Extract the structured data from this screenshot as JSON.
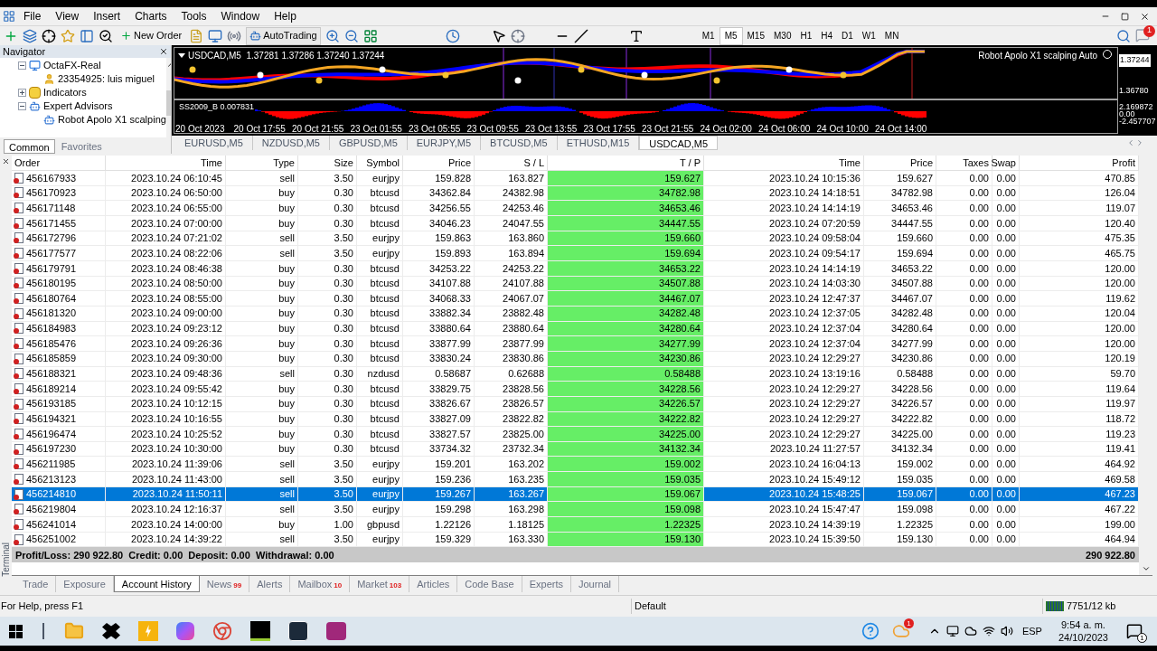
{
  "menu": [
    "File",
    "View",
    "Insert",
    "Charts",
    "Tools",
    "Window",
    "Help"
  ],
  "toolbar": {
    "new_order": "New Order",
    "autotrading": "AutoTrading",
    "timeframes": [
      {
        "label": "M1",
        "selected": false
      },
      {
        "label": "M5",
        "selected": true
      },
      {
        "label": "M15",
        "selected": false
      },
      {
        "label": "M30",
        "selected": false
      },
      {
        "label": "H1",
        "selected": false
      },
      {
        "label": "H4",
        "selected": false
      },
      {
        "label": "D1",
        "selected": false
      },
      {
        "label": "W1",
        "selected": false
      },
      {
        "label": "MN",
        "selected": false
      }
    ],
    "notifications": "1"
  },
  "navigator": {
    "title": "Navigator",
    "tree": [
      {
        "label": "OctaFX-Real",
        "kind": "server",
        "expanded": true,
        "children": [
          {
            "label": "23354925: luis miguel",
            "kind": "account"
          }
        ]
      },
      {
        "label": "Indicators",
        "kind": "indicators",
        "expanded": false
      },
      {
        "label": "Expert Advisors",
        "kind": "experts",
        "expanded": true,
        "children": [
          {
            "label": "Robot Apolo X1 scalping",
            "kind": "expert"
          }
        ]
      }
    ],
    "tabs": [
      {
        "label": "Common",
        "selected": true
      },
      {
        "label": "Favorites",
        "selected": false
      }
    ]
  },
  "chart": {
    "legend": "USDCAD,M5  1.37281 1.37286 1.37240 1.37244",
    "expert": "Robot Apolo X1 scalping Auto",
    "price_current": "1.37244",
    "price_label": "1.36780",
    "indicator_legend": "SS2009_B 0.007831",
    "indicator_scale": [
      "2.169872",
      "0.00",
      "-2.457707"
    ],
    "time_labels": [
      "20 Oct 2023",
      "20 Oct 17:55",
      "20 Oct 21:55",
      "23 Oct 01:55",
      "23 Oct 05:55",
      "23 Oct 09:55",
      "23 Oct 13:55",
      "23 Oct 17:55",
      "23 Oct 21:55",
      "24 Oct 02:00",
      "24 Oct 06:00",
      "24 Oct 10:00",
      "24 Oct 14:00"
    ]
  },
  "chart_tabs": [
    {
      "label": "EURUSD,M5",
      "selected": false
    },
    {
      "label": "NZDUSD,M5",
      "selected": false
    },
    {
      "label": "GBPUSD,M5",
      "selected": false
    },
    {
      "label": "EURJPY,M5",
      "selected": false
    },
    {
      "label": "BTCUSD,M5",
      "selected": false
    },
    {
      "label": "ETHUSD,M15",
      "selected": false
    },
    {
      "label": "USDCAD,M5",
      "selected": true
    }
  ],
  "table": {
    "columns": [
      "Order",
      "Time",
      "Type",
      "Size",
      "Symbol",
      "Price",
      "S / L",
      "T / P",
      "Time",
      "Price",
      "Taxes",
      "Swap",
      "Profit"
    ],
    "rows": [
      {
        "selected": false,
        "tp_hit": true,
        "cells": [
          "456167933",
          "2023.10.24 06:10:45",
          "sell",
          "3.50",
          "eurjpy",
          "159.828",
          "163.827",
          "159.627",
          "2023.10.24 10:15:36",
          "159.627",
          "0.00",
          "0.00",
          "470.85"
        ]
      },
      {
        "selected": false,
        "tp_hit": true,
        "cells": [
          "456170923",
          "2023.10.24 06:50:00",
          "buy",
          "0.30",
          "btcusd",
          "34362.84",
          "24382.98",
          "34782.98",
          "2023.10.24 14:18:51",
          "34782.98",
          "0.00",
          "0.00",
          "126.04"
        ]
      },
      {
        "selected": false,
        "tp_hit": true,
        "cells": [
          "456171148",
          "2023.10.24 06:55:00",
          "buy",
          "0.30",
          "btcusd",
          "34256.55",
          "24253.46",
          "34653.46",
          "2023.10.24 14:14:19",
          "34653.46",
          "0.00",
          "0.00",
          "119.07"
        ]
      },
      {
        "selected": false,
        "tp_hit": true,
        "cells": [
          "456171455",
          "2023.10.24 07:00:00",
          "buy",
          "0.30",
          "btcusd",
          "34046.23",
          "24047.55",
          "34447.55",
          "2023.10.24 07:20:59",
          "34447.55",
          "0.00",
          "0.00",
          "120.40"
        ]
      },
      {
        "selected": false,
        "tp_hit": true,
        "cells": [
          "456172796",
          "2023.10.24 07:21:02",
          "sell",
          "3.50",
          "eurjpy",
          "159.863",
          "163.860",
          "159.660",
          "2023.10.24 09:58:04",
          "159.660",
          "0.00",
          "0.00",
          "475.35"
        ]
      },
      {
        "selected": false,
        "tp_hit": true,
        "cells": [
          "456177577",
          "2023.10.24 08:22:06",
          "sell",
          "3.50",
          "eurjpy",
          "159.893",
          "163.894",
          "159.694",
          "2023.10.24 09:54:17",
          "159.694",
          "0.00",
          "0.00",
          "465.75"
        ]
      },
      {
        "selected": false,
        "tp_hit": true,
        "cells": [
          "456179791",
          "2023.10.24 08:46:38",
          "buy",
          "0.30",
          "btcusd",
          "34253.22",
          "24253.22",
          "34653.22",
          "2023.10.24 14:14:19",
          "34653.22",
          "0.00",
          "0.00",
          "120.00"
        ]
      },
      {
        "selected": false,
        "tp_hit": true,
        "cells": [
          "456180195",
          "2023.10.24 08:50:00",
          "buy",
          "0.30",
          "btcusd",
          "34107.88",
          "24107.88",
          "34507.88",
          "2023.10.24 14:03:30",
          "34507.88",
          "0.00",
          "0.00",
          "120.00"
        ]
      },
      {
        "selected": false,
        "tp_hit": true,
        "cells": [
          "456180764",
          "2023.10.24 08:55:00",
          "buy",
          "0.30",
          "btcusd",
          "34068.33",
          "24067.07",
          "34467.07",
          "2023.10.24 12:47:37",
          "34467.07",
          "0.00",
          "0.00",
          "119.62"
        ]
      },
      {
        "selected": false,
        "tp_hit": true,
        "cells": [
          "456181320",
          "2023.10.24 09:00:00",
          "buy",
          "0.30",
          "btcusd",
          "33882.34",
          "23882.48",
          "34282.48",
          "2023.10.24 12:37:05",
          "34282.48",
          "0.00",
          "0.00",
          "120.04"
        ]
      },
      {
        "selected": false,
        "tp_hit": true,
        "cells": [
          "456184983",
          "2023.10.24 09:23:12",
          "buy",
          "0.30",
          "btcusd",
          "33880.64",
          "23880.64",
          "34280.64",
          "2023.10.24 12:37:04",
          "34280.64",
          "0.00",
          "0.00",
          "120.00"
        ]
      },
      {
        "selected": false,
        "tp_hit": true,
        "cells": [
          "456185476",
          "2023.10.24 09:26:36",
          "buy",
          "0.30",
          "btcusd",
          "33877.99",
          "23877.99",
          "34277.99",
          "2023.10.24 12:37:04",
          "34277.99",
          "0.00",
          "0.00",
          "120.00"
        ]
      },
      {
        "selected": false,
        "tp_hit": true,
        "cells": [
          "456185859",
          "2023.10.24 09:30:00",
          "buy",
          "0.30",
          "btcusd",
          "33830.24",
          "23830.86",
          "34230.86",
          "2023.10.24 12:29:27",
          "34230.86",
          "0.00",
          "0.00",
          "120.19"
        ]
      },
      {
        "selected": false,
        "tp_hit": true,
        "cells": [
          "456188321",
          "2023.10.24 09:48:36",
          "sell",
          "0.30",
          "nzdusd",
          "0.58687",
          "0.62688",
          "0.58488",
          "2023.10.24 13:19:16",
          "0.58488",
          "0.00",
          "0.00",
          "59.70"
        ]
      },
      {
        "selected": false,
        "tp_hit": true,
        "cells": [
          "456189214",
          "2023.10.24 09:55:42",
          "buy",
          "0.30",
          "btcusd",
          "33829.75",
          "23828.56",
          "34228.56",
          "2023.10.24 12:29:27",
          "34228.56",
          "0.00",
          "0.00",
          "119.64"
        ]
      },
      {
        "selected": false,
        "tp_hit": true,
        "cells": [
          "456193185",
          "2023.10.24 10:12:15",
          "buy",
          "0.30",
          "btcusd",
          "33826.67",
          "23826.57",
          "34226.57",
          "2023.10.24 12:29:27",
          "34226.57",
          "0.00",
          "0.00",
          "119.97"
        ]
      },
      {
        "selected": false,
        "tp_hit": true,
        "cells": [
          "456194321",
          "2023.10.24 10:16:55",
          "buy",
          "0.30",
          "btcusd",
          "33827.09",
          "23822.82",
          "34222.82",
          "2023.10.24 12:29:27",
          "34222.82",
          "0.00",
          "0.00",
          "118.72"
        ]
      },
      {
        "selected": false,
        "tp_hit": true,
        "cells": [
          "456196474",
          "2023.10.24 10:25:52",
          "buy",
          "0.30",
          "btcusd",
          "33827.57",
          "23825.00",
          "34225.00",
          "2023.10.24 12:29:27",
          "34225.00",
          "0.00",
          "0.00",
          "119.23"
        ]
      },
      {
        "selected": false,
        "tp_hit": true,
        "cells": [
          "456197230",
          "2023.10.24 10:30:00",
          "buy",
          "0.30",
          "btcusd",
          "33734.32",
          "23732.34",
          "34132.34",
          "2023.10.24 11:27:57",
          "34132.34",
          "0.00",
          "0.00",
          "119.41"
        ]
      },
      {
        "selected": false,
        "tp_hit": true,
        "cells": [
          "456211985",
          "2023.10.24 11:39:06",
          "sell",
          "3.50",
          "eurjpy",
          "159.201",
          "163.202",
          "159.002",
          "2023.10.24 16:04:13",
          "159.002",
          "0.00",
          "0.00",
          "464.92"
        ]
      },
      {
        "selected": false,
        "tp_hit": true,
        "cells": [
          "456213123",
          "2023.10.24 11:43:00",
          "sell",
          "3.50",
          "eurjpy",
          "159.236",
          "163.235",
          "159.035",
          "2023.10.24 15:49:12",
          "159.035",
          "0.00",
          "0.00",
          "469.58"
        ]
      },
      {
        "selected": true,
        "tp_hit": true,
        "cells": [
          "456214810",
          "2023.10.24 11:50:11",
          "sell",
          "3.50",
          "eurjpy",
          "159.267",
          "163.267",
          "159.067",
          "2023.10.24 15:48:25",
          "159.067",
          "0.00",
          "0.00",
          "467.23"
        ]
      },
      {
        "selected": false,
        "tp_hit": true,
        "cells": [
          "456219804",
          "2023.10.24 12:16:37",
          "sell",
          "3.50",
          "eurjpy",
          "159.298",
          "163.298",
          "159.098",
          "2023.10.24 15:47:47",
          "159.098",
          "0.00",
          "0.00",
          "467.22"
        ]
      },
      {
        "selected": false,
        "tp_hit": true,
        "cells": [
          "456241014",
          "2023.10.24 14:00:00",
          "buy",
          "1.00",
          "gbpusd",
          "1.22126",
          "1.18125",
          "1.22325",
          "2023.10.24 14:39:19",
          "1.22325",
          "0.00",
          "0.00",
          "199.00"
        ]
      },
      {
        "selected": false,
        "tp_hit": true,
        "cells": [
          "456251002",
          "2023.10.24 14:39:22",
          "sell",
          "3.50",
          "eurjpy",
          "159.329",
          "163.330",
          "159.130",
          "2023.10.24 15:39:50",
          "159.130",
          "0.00",
          "0.00",
          "464.94"
        ]
      }
    ],
    "summary": "Profit/Loss: 290 922.80  Credit: 0.00  Deposit: 0.00  Withdrawal: 0.00",
    "total": "290 922.80"
  },
  "terminal": {
    "label": "Terminal",
    "tabs": [
      {
        "label": "Trade",
        "selected": false
      },
      {
        "label": "Exposure",
        "selected": false
      },
      {
        "label": "Account History",
        "selected": true
      },
      {
        "label": "News",
        "badge": "99",
        "selected": false
      },
      {
        "label": "Alerts",
        "selected": false
      },
      {
        "label": "Mailbox",
        "badge": "10",
        "selected": false
      },
      {
        "label": "Market",
        "badge": "103",
        "selected": false
      },
      {
        "label": "Articles",
        "selected": false
      },
      {
        "label": "Code Base",
        "selected": false
      },
      {
        "label": "Experts",
        "selected": false
      },
      {
        "label": "Journal",
        "selected": false
      }
    ]
  },
  "status_bar": {
    "help": "For Help, press F1",
    "profile": "Default",
    "traffic": "7751/12 kb"
  },
  "taskbar": {
    "weather_badge": "1",
    "language": "ESP",
    "time": "9:54 a. m.",
    "date": "24/10/2023",
    "notification_count": "1"
  }
}
